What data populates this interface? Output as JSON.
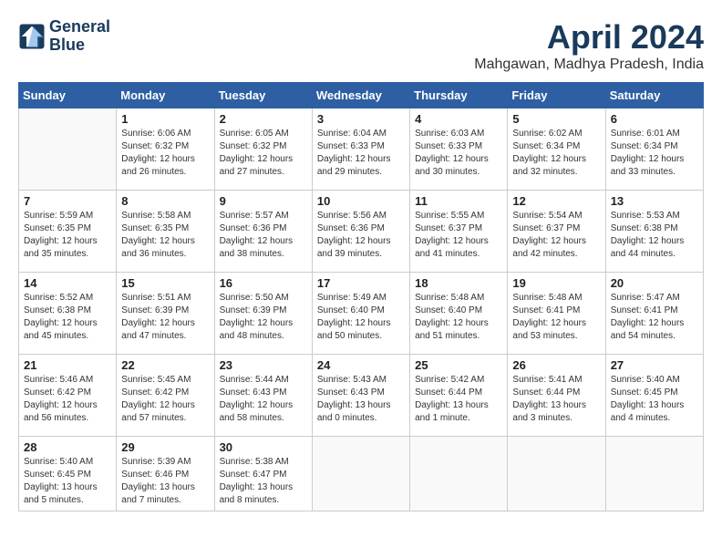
{
  "header": {
    "logo_line1": "General",
    "logo_line2": "Blue",
    "month_title": "April 2024",
    "location": "Mahgawan, Madhya Pradesh, India"
  },
  "weekdays": [
    "Sunday",
    "Monday",
    "Tuesday",
    "Wednesday",
    "Thursday",
    "Friday",
    "Saturday"
  ],
  "weeks": [
    [
      {
        "day": "",
        "info": ""
      },
      {
        "day": "1",
        "info": "Sunrise: 6:06 AM\nSunset: 6:32 PM\nDaylight: 12 hours\nand 26 minutes."
      },
      {
        "day": "2",
        "info": "Sunrise: 6:05 AM\nSunset: 6:32 PM\nDaylight: 12 hours\nand 27 minutes."
      },
      {
        "day": "3",
        "info": "Sunrise: 6:04 AM\nSunset: 6:33 PM\nDaylight: 12 hours\nand 29 minutes."
      },
      {
        "day": "4",
        "info": "Sunrise: 6:03 AM\nSunset: 6:33 PM\nDaylight: 12 hours\nand 30 minutes."
      },
      {
        "day": "5",
        "info": "Sunrise: 6:02 AM\nSunset: 6:34 PM\nDaylight: 12 hours\nand 32 minutes."
      },
      {
        "day": "6",
        "info": "Sunrise: 6:01 AM\nSunset: 6:34 PM\nDaylight: 12 hours\nand 33 minutes."
      }
    ],
    [
      {
        "day": "7",
        "info": "Sunrise: 5:59 AM\nSunset: 6:35 PM\nDaylight: 12 hours\nand 35 minutes."
      },
      {
        "day": "8",
        "info": "Sunrise: 5:58 AM\nSunset: 6:35 PM\nDaylight: 12 hours\nand 36 minutes."
      },
      {
        "day": "9",
        "info": "Sunrise: 5:57 AM\nSunset: 6:36 PM\nDaylight: 12 hours\nand 38 minutes."
      },
      {
        "day": "10",
        "info": "Sunrise: 5:56 AM\nSunset: 6:36 PM\nDaylight: 12 hours\nand 39 minutes."
      },
      {
        "day": "11",
        "info": "Sunrise: 5:55 AM\nSunset: 6:37 PM\nDaylight: 12 hours\nand 41 minutes."
      },
      {
        "day": "12",
        "info": "Sunrise: 5:54 AM\nSunset: 6:37 PM\nDaylight: 12 hours\nand 42 minutes."
      },
      {
        "day": "13",
        "info": "Sunrise: 5:53 AM\nSunset: 6:38 PM\nDaylight: 12 hours\nand 44 minutes."
      }
    ],
    [
      {
        "day": "14",
        "info": "Sunrise: 5:52 AM\nSunset: 6:38 PM\nDaylight: 12 hours\nand 45 minutes."
      },
      {
        "day": "15",
        "info": "Sunrise: 5:51 AM\nSunset: 6:39 PM\nDaylight: 12 hours\nand 47 minutes."
      },
      {
        "day": "16",
        "info": "Sunrise: 5:50 AM\nSunset: 6:39 PM\nDaylight: 12 hours\nand 48 minutes."
      },
      {
        "day": "17",
        "info": "Sunrise: 5:49 AM\nSunset: 6:40 PM\nDaylight: 12 hours\nand 50 minutes."
      },
      {
        "day": "18",
        "info": "Sunrise: 5:48 AM\nSunset: 6:40 PM\nDaylight: 12 hours\nand 51 minutes."
      },
      {
        "day": "19",
        "info": "Sunrise: 5:48 AM\nSunset: 6:41 PM\nDaylight: 12 hours\nand 53 minutes."
      },
      {
        "day": "20",
        "info": "Sunrise: 5:47 AM\nSunset: 6:41 PM\nDaylight: 12 hours\nand 54 minutes."
      }
    ],
    [
      {
        "day": "21",
        "info": "Sunrise: 5:46 AM\nSunset: 6:42 PM\nDaylight: 12 hours\nand 56 minutes."
      },
      {
        "day": "22",
        "info": "Sunrise: 5:45 AM\nSunset: 6:42 PM\nDaylight: 12 hours\nand 57 minutes."
      },
      {
        "day": "23",
        "info": "Sunrise: 5:44 AM\nSunset: 6:43 PM\nDaylight: 12 hours\nand 58 minutes."
      },
      {
        "day": "24",
        "info": "Sunrise: 5:43 AM\nSunset: 6:43 PM\nDaylight: 13 hours\nand 0 minutes."
      },
      {
        "day": "25",
        "info": "Sunrise: 5:42 AM\nSunset: 6:44 PM\nDaylight: 13 hours\nand 1 minute."
      },
      {
        "day": "26",
        "info": "Sunrise: 5:41 AM\nSunset: 6:44 PM\nDaylight: 13 hours\nand 3 minutes."
      },
      {
        "day": "27",
        "info": "Sunrise: 5:40 AM\nSunset: 6:45 PM\nDaylight: 13 hours\nand 4 minutes."
      }
    ],
    [
      {
        "day": "28",
        "info": "Sunrise: 5:40 AM\nSunset: 6:45 PM\nDaylight: 13 hours\nand 5 minutes."
      },
      {
        "day": "29",
        "info": "Sunrise: 5:39 AM\nSunset: 6:46 PM\nDaylight: 13 hours\nand 7 minutes."
      },
      {
        "day": "30",
        "info": "Sunrise: 5:38 AM\nSunset: 6:47 PM\nDaylight: 13 hours\nand 8 minutes."
      },
      {
        "day": "",
        "info": ""
      },
      {
        "day": "",
        "info": ""
      },
      {
        "day": "",
        "info": ""
      },
      {
        "day": "",
        "info": ""
      }
    ]
  ]
}
